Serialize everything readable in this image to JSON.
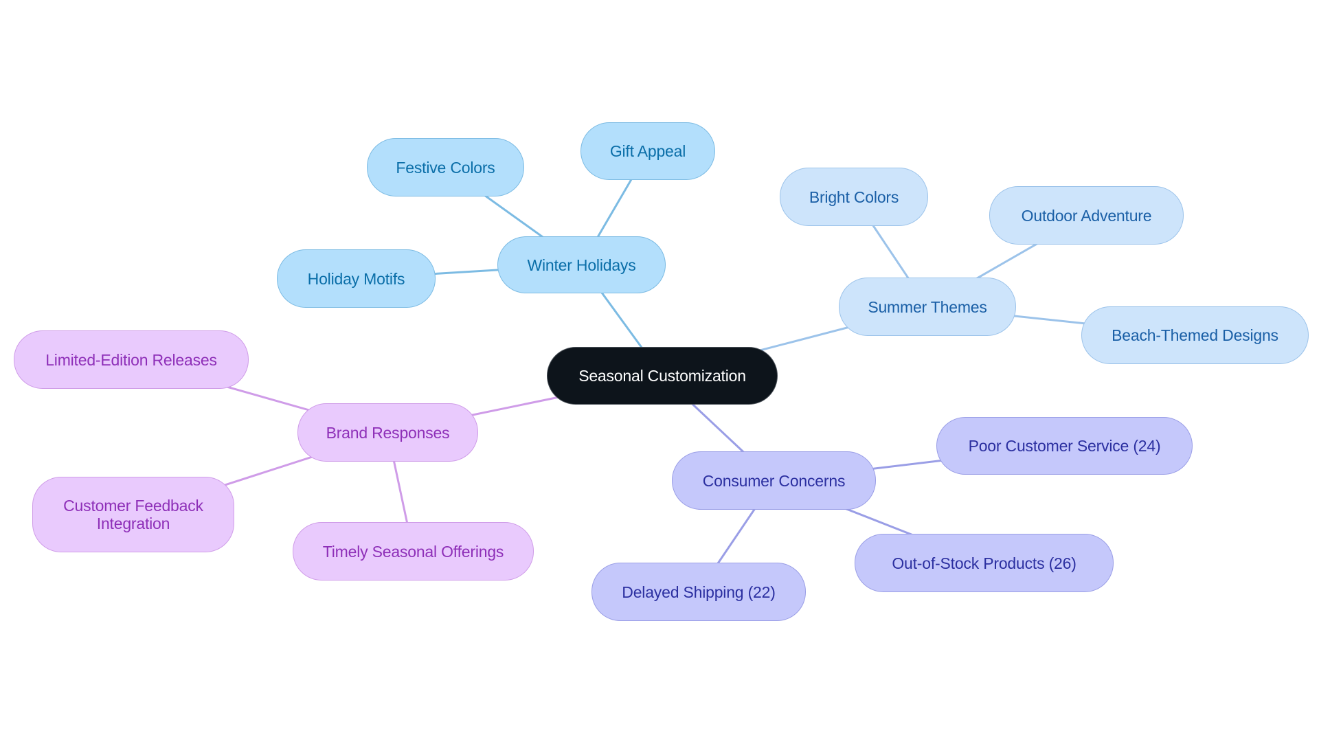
{
  "diagram": {
    "type": "mindmap",
    "root": {
      "id": "root",
      "label": "Seasonal Customization"
    },
    "branches": [
      {
        "id": "winter",
        "label": "Winter Holidays",
        "color": "#7cbbe3",
        "children": [
          {
            "id": "festive",
            "label": "Festive Colors"
          },
          {
            "id": "gift",
            "label": "Gift Appeal"
          },
          {
            "id": "motifs",
            "label": "Holiday Motifs"
          }
        ]
      },
      {
        "id": "summer",
        "label": "Summer Themes",
        "color": "#9cc3ea",
        "children": [
          {
            "id": "bright",
            "label": "Bright Colors"
          },
          {
            "id": "outdoor",
            "label": "Outdoor Adventure"
          },
          {
            "id": "beach",
            "label": "Beach-Themed Designs"
          }
        ]
      },
      {
        "id": "concern",
        "label": "Consumer Concerns",
        "color": "#9a9ee6",
        "children": [
          {
            "id": "service",
            "label": "Poor Customer Service (24)"
          },
          {
            "id": "stock",
            "label": "Out-of-Stock Products (26)"
          },
          {
            "id": "shipping",
            "label": "Delayed Shipping (22)"
          }
        ]
      },
      {
        "id": "brand",
        "label": "Brand Responses",
        "color": "#cf9ce8",
        "children": [
          {
            "id": "limited",
            "label": "Limited-Edition Releases"
          },
          {
            "id": "feedback",
            "label": "Customer Feedback Integration"
          },
          {
            "id": "timely",
            "label": "Timely Seasonal Offerings"
          }
        ]
      }
    ]
  }
}
